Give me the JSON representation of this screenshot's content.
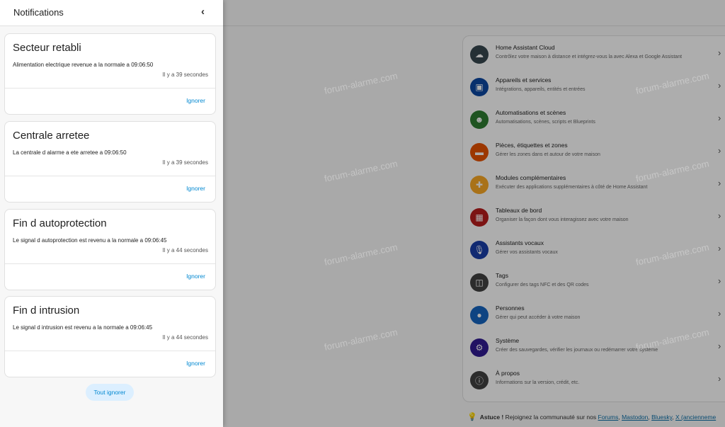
{
  "drawer": {
    "title": "Notifications",
    "close_icon": "chevron-left-icon",
    "notifications": [
      {
        "title": "Secteur retabli",
        "message": "Alimentation electrique revenue a la normale a 09:06:50",
        "time": "Il y a 39 secondes",
        "dismiss": "Ignorer"
      },
      {
        "title": "Centrale arretee",
        "message": "La centrale d alarme a ete arretee a 09:06:50",
        "time": "Il y a 39 secondes",
        "dismiss": "Ignorer"
      },
      {
        "title": "Fin d autoprotection",
        "message": "Le signal d autoprotection est revenu a la normale a 09:06:45",
        "time": "Il y a 44 secondes",
        "dismiss": "Ignorer"
      },
      {
        "title": "Fin d intrusion",
        "message": "Le signal d intrusion est revenu a la normale a 09:06:45",
        "time": "Il y a 44 secondes",
        "dismiss": "Ignorer"
      }
    ],
    "dismiss_all": "Tout ignorer"
  },
  "settings": {
    "items": [
      {
        "title": "Home Assistant Cloud",
        "desc": "Contrôlez votre maison à distance et intégrez-vous la avec Alexa et Google Assistant",
        "icon": "cloud-icon",
        "color": "#37474f"
      },
      {
        "title": "Appareils et services",
        "desc": "Intégrations, appareils, entités et entrées",
        "icon": "devices-icon",
        "color": "#0d47a1"
      },
      {
        "title": "Automatisations et scènes",
        "desc": "Automatisations, scènes, scripts et Blueprints",
        "icon": "robot-icon",
        "color": "#2e7d32"
      },
      {
        "title": "Pièces, étiquettes et zones",
        "desc": "Gérer les zones dans et autour de votre maison",
        "icon": "sofa-icon",
        "color": "#e65100"
      },
      {
        "title": "Modules complémentaires",
        "desc": "Exécuter des applications supplémentaires à côté de Home Assistant",
        "icon": "puzzle-icon",
        "color": "#f9a825"
      },
      {
        "title": "Tableaux de bord",
        "desc": "Organiser la façon dont vous interagissez avec votre maison",
        "icon": "dashboard-icon",
        "color": "#b71c1c"
      },
      {
        "title": "Assistants vocaux",
        "desc": "Gérer vos assistants vocaux",
        "icon": "microphone-icon",
        "color": "#1a3fa8"
      },
      {
        "title": "Tags",
        "desc": "Configurer des tags NFC et des QR codes",
        "icon": "nfc-icon",
        "color": "#424242"
      },
      {
        "title": "Personnes",
        "desc": "Gérer qui peut accéder à votre maison",
        "icon": "account-icon",
        "color": "#1565c0"
      },
      {
        "title": "Système",
        "desc": "Créer des sauvegardes, vérifier les journaux ou redémarrer votre système",
        "icon": "cog-icon",
        "color": "#311b92"
      },
      {
        "title": "À propos",
        "desc": "Informations sur la version, crédit, etc.",
        "icon": "info-icon",
        "color": "#424242"
      }
    ]
  },
  "tip": {
    "label": "Astuce !",
    "text": "Rejoignez la communauté sur nos",
    "links": [
      "Forums",
      "Mastodon",
      "Bluesky",
      "X (ancienneme"
    ],
    "icon": "lightbulb-icon"
  },
  "watermark": "forum-alarme.com"
}
